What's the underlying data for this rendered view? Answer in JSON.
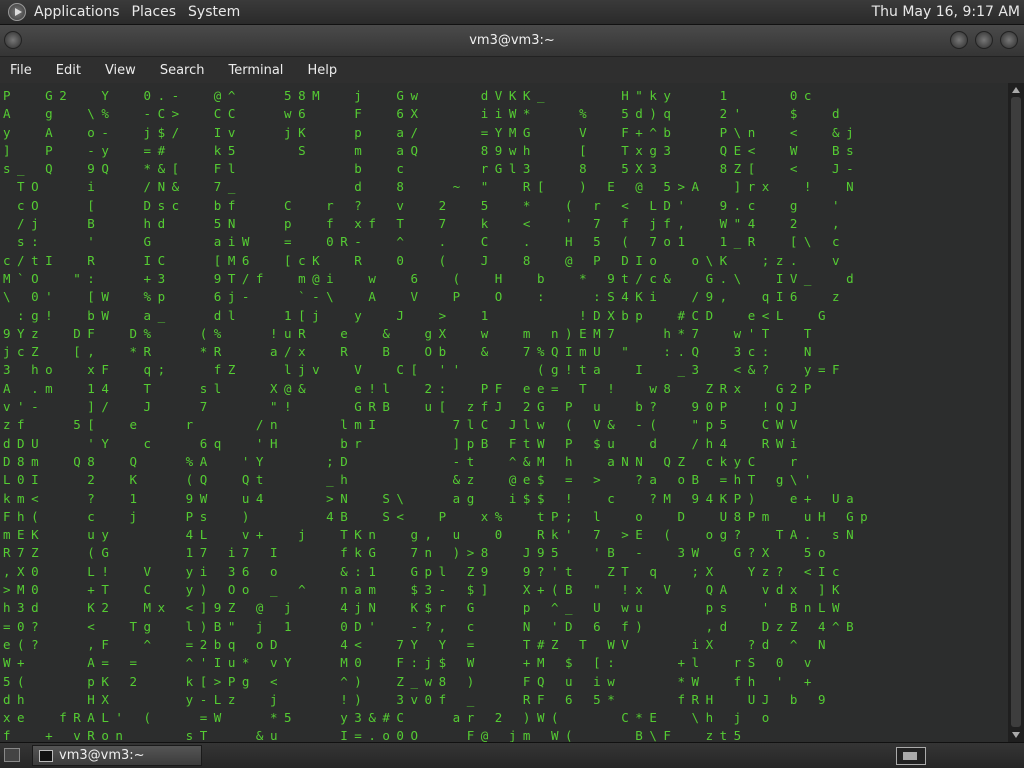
{
  "top_panel": {
    "menus": [
      "Applications",
      "Places",
      "System"
    ],
    "clock": "Thu May 16,  9:17 AM"
  },
  "window": {
    "title": "vm3@vm3:~"
  },
  "menubar": {
    "items": [
      "File",
      "Edit",
      "View",
      "Search",
      "Terminal",
      "Help"
    ]
  },
  "terminal": {
    "rows": [
      "P  G2  Y  0.-  @^   58M  j  Gw    dVKK_     H\"ky   1    0c",
      "A  g  \\%  -C>  CC   w6   F  6X    iiW*   %  5d)q   2'   $  d",
      "y  A  o-  j$/  Iv   jK   p  a/    =YMG   V  F+^b   P\\n  <  &j",
      "]  P  -y  =#   k5    S   m  aQ    89wh   [  Txg3   QE<  W  Bs",
      "s_ Q  9Q  *&[  Fl        b  c     rGl3   8  5X3    8Z[  <  J-",
      " TO   i   /N&  7_        d  8   ~ \"  R[  ) E @ 5>A  ]rx  !  N",
      " cO   [   Dsc  bf   C  r ?  v  2  5  *  ( r < LD'  9.c  g  '",
      " /j   B   hd   5N   p  f xf T  7  k  <  ' 7 f jf,  W\"4  2  ,",
      " s:   '   G    aiW  =  0R-  ^  .  C  .  H 5 ( 7o1  1_R  [\\ c",
      "c/tI  R   IC   [M6  [cK  R  0  (  J  8  @ P DIo  o\\K  ;z.  v",
      "M`O  \":   +3   9T/f  m@i  w  6  (  H  b  * 9t/c&  G.\\  IV_  d",
      "\\ 0'  [W  %p   6j-   `-\\  A  V  P  O  :   :S4Ki  /9,  qI6  z",
      " :g!  bW  a_   dl   1[j  y  J  >  1      !DXbp  #CD  e<L  G",
      "9Yz  DF  D%   (%   !uR  e  &  gX  w  m n)EM7   h*7  w'T  T",
      "jcZ  [,  *R   *R   a/x  R  B  Ob  &  7%QImU \"  :.Q  3c:  N",
      "3 ho  xF  q;   fZ   ljv  V  C[ ''     (g!ta  I  _3  <&?  y=F",
      "A .m  14  T   sl   X@&   e!l  2:  PF ee= T !  w8  ZRx  G2P",
      "v'-   ]/  J   7    \"!    GRB  u[ zfJ 2G P u  b?  90P  !QJ",
      "zf   5[  e   r    /n    lmI     7lC Jlw ( V& -(  \"p5  CWV",
      "dDU   'Y  c   6q  'H    br      ]pB FtW P $u  d  /h4  RWi",
      "D8m  Q8  Q   %A  'Y    ;D       -t  ^&M h  aNN QZ ckyC  r",
      "L0I   2  K   (Q  Qt    _h       &z  @e$ = >  ?a oB =hT g\\'",
      "km<   ?  1   9W  u4    >N  S\\   ag  i$$ !  c  ?M 94KP)  e+ Ua",
      "Fh(   c  j   Ps  )     4B  S<  P  x%  tP; l  o  D  U8Pm  uH Gp",
      "mEK   uy     4L  v+  j  TKn  g, u  0  Rk' 7 >E (  og?  TA. sN",
      "R7Z   (G     17 i7 I    fkG  7n )>8  J95  'B -  3W  G?X  5o",
      ",X0   L!  V  yi 36 o    &:1  Gpl Z9  9?'t  ZT q  ;X  Yz? <Ic",
      ">M0   +T  C  y) Oo _ ^  nam  $3- $]  X+(B \" !x V  QA  vdx ]K",
      "h3d   K2  Mx <]9Z @ j   4jN  K$r G   p ^_ U wu    ps  ' BnLW",
      "=0?   <  Tg  l)B\" j 1   0D'  -?, c   N 'D 6 f)    ,d  DzZ 4^B",
      "e(?   ,F  ^  =2bq oD    4<  7Y Y =   T#Z T WV    iX  ?d ^ N",
      "W+    A= =   ^'Iu* vY   M0  F:j$ W   +M $ [:    +l  rS 0 v",
      "5(    pK 2   k[>Pg <    ^)  Z_w8 )   FQ u iw    *W  fh ' +",
      "dh    HX     y-Lz  j    !)  3v0f _   RF 6 5*    fRH  UJ b 9",
      "xe  fRAL' (   =W   *5   y3&#C   ar 2 )W(    C*E  \\h j o",
      "f  + vRon    sT   &u    I=.o0O   F@ jm W(    B\\F  zt5  "
    ]
  }
}
